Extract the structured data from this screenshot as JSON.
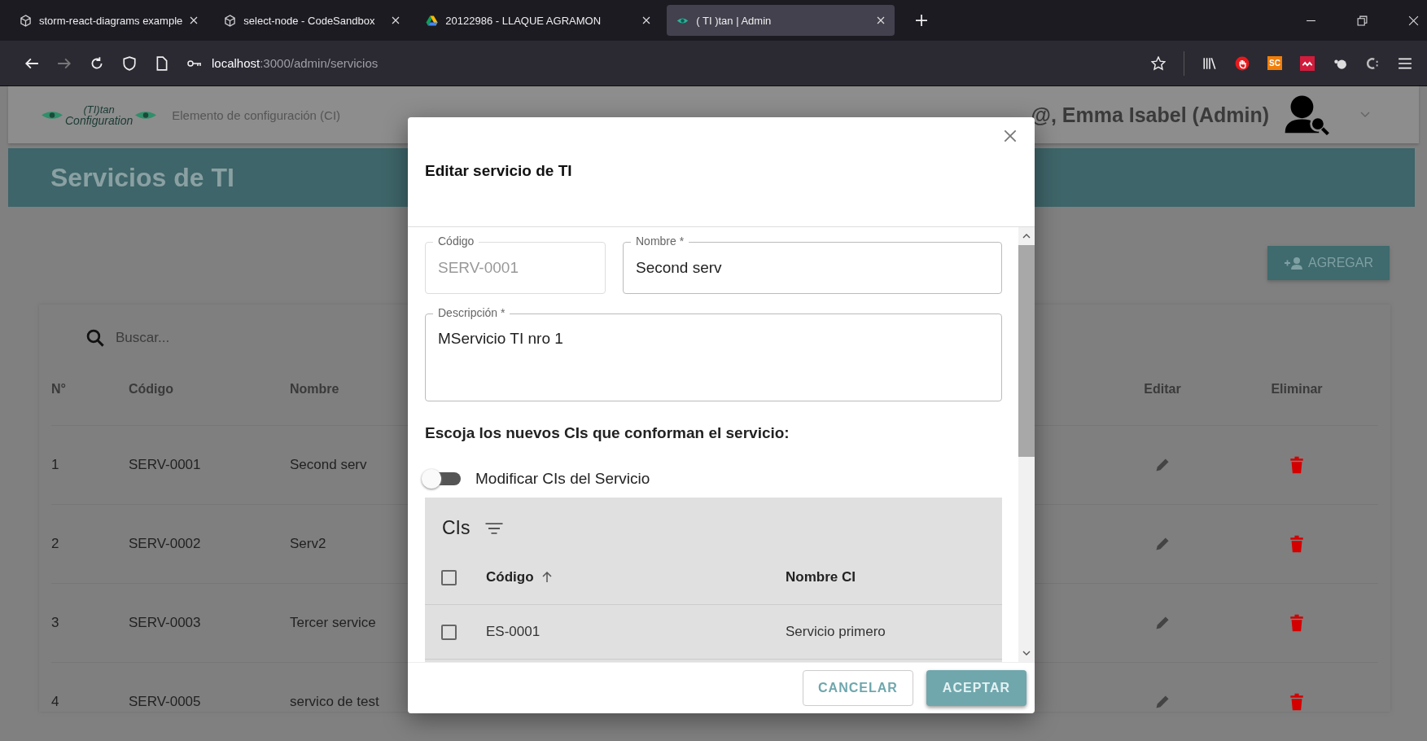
{
  "browser": {
    "tabs": [
      {
        "title": "storm-react-diagrams example",
        "kind": "cube",
        "selected": false
      },
      {
        "title": "select-node - CodeSandbox",
        "kind": "cube",
        "selected": false
      },
      {
        "title": "20122986 - LLAQUE AGRAMON",
        "kind": "drive",
        "selected": false
      },
      {
        "title": "( TI )tan | Admin",
        "kind": "titan",
        "selected": true
      }
    ],
    "url": {
      "host": "localhost",
      "path": ":3000/admin/servicios"
    },
    "extension_label": "SC"
  },
  "app": {
    "logo": {
      "top": "(TI)tan",
      "bottom": "Configuration"
    },
    "nav": [
      "Elemento de configuración (CI)"
    ],
    "greeting": "@, Emma Isabel (Admin)",
    "page_title": "Servicios de TI",
    "add_button": "AGREGAR",
    "search": {
      "placeholder": "Buscar..."
    },
    "columns": [
      "N°",
      "Código",
      "Nombre",
      "Editar",
      "Eliminar"
    ],
    "rows": [
      {
        "n": "1",
        "code": "SERV-0001",
        "name": "Second serv"
      },
      {
        "n": "2",
        "code": "SERV-0002",
        "name": "Serv2"
      },
      {
        "n": "3",
        "code": "SERV-0003",
        "name": "Tercer service"
      },
      {
        "n": "4",
        "code": "SERV-0005",
        "name": "servico de test"
      }
    ]
  },
  "dialog": {
    "title": "Editar servicio de TI",
    "fields": [
      {
        "label": "Código",
        "value": "SERV-0001",
        "disabled": true
      },
      {
        "label": "Nombre *",
        "value": "Second serv",
        "disabled": false
      }
    ],
    "description": {
      "label": "Descripción *",
      "value": "MServicio TI nro 1"
    },
    "section_heading": "Escoja los nuevos CIs que conforman el servicio:",
    "switch": {
      "label": "Modificar CIs del Servicio",
      "on": false
    },
    "cis": {
      "title": "CIs",
      "all_checked": false,
      "columns": [
        {
          "label": "Código",
          "sorted": true
        },
        {
          "label": "Nombre CI",
          "sorted": false
        }
      ],
      "rows": [
        {
          "code": "ES-0001",
          "name": "Servicio primero",
          "checked": false
        }
      ]
    },
    "buttons": {
      "cancel": "CANCELAR",
      "accept": "ACEPTAR"
    }
  }
}
